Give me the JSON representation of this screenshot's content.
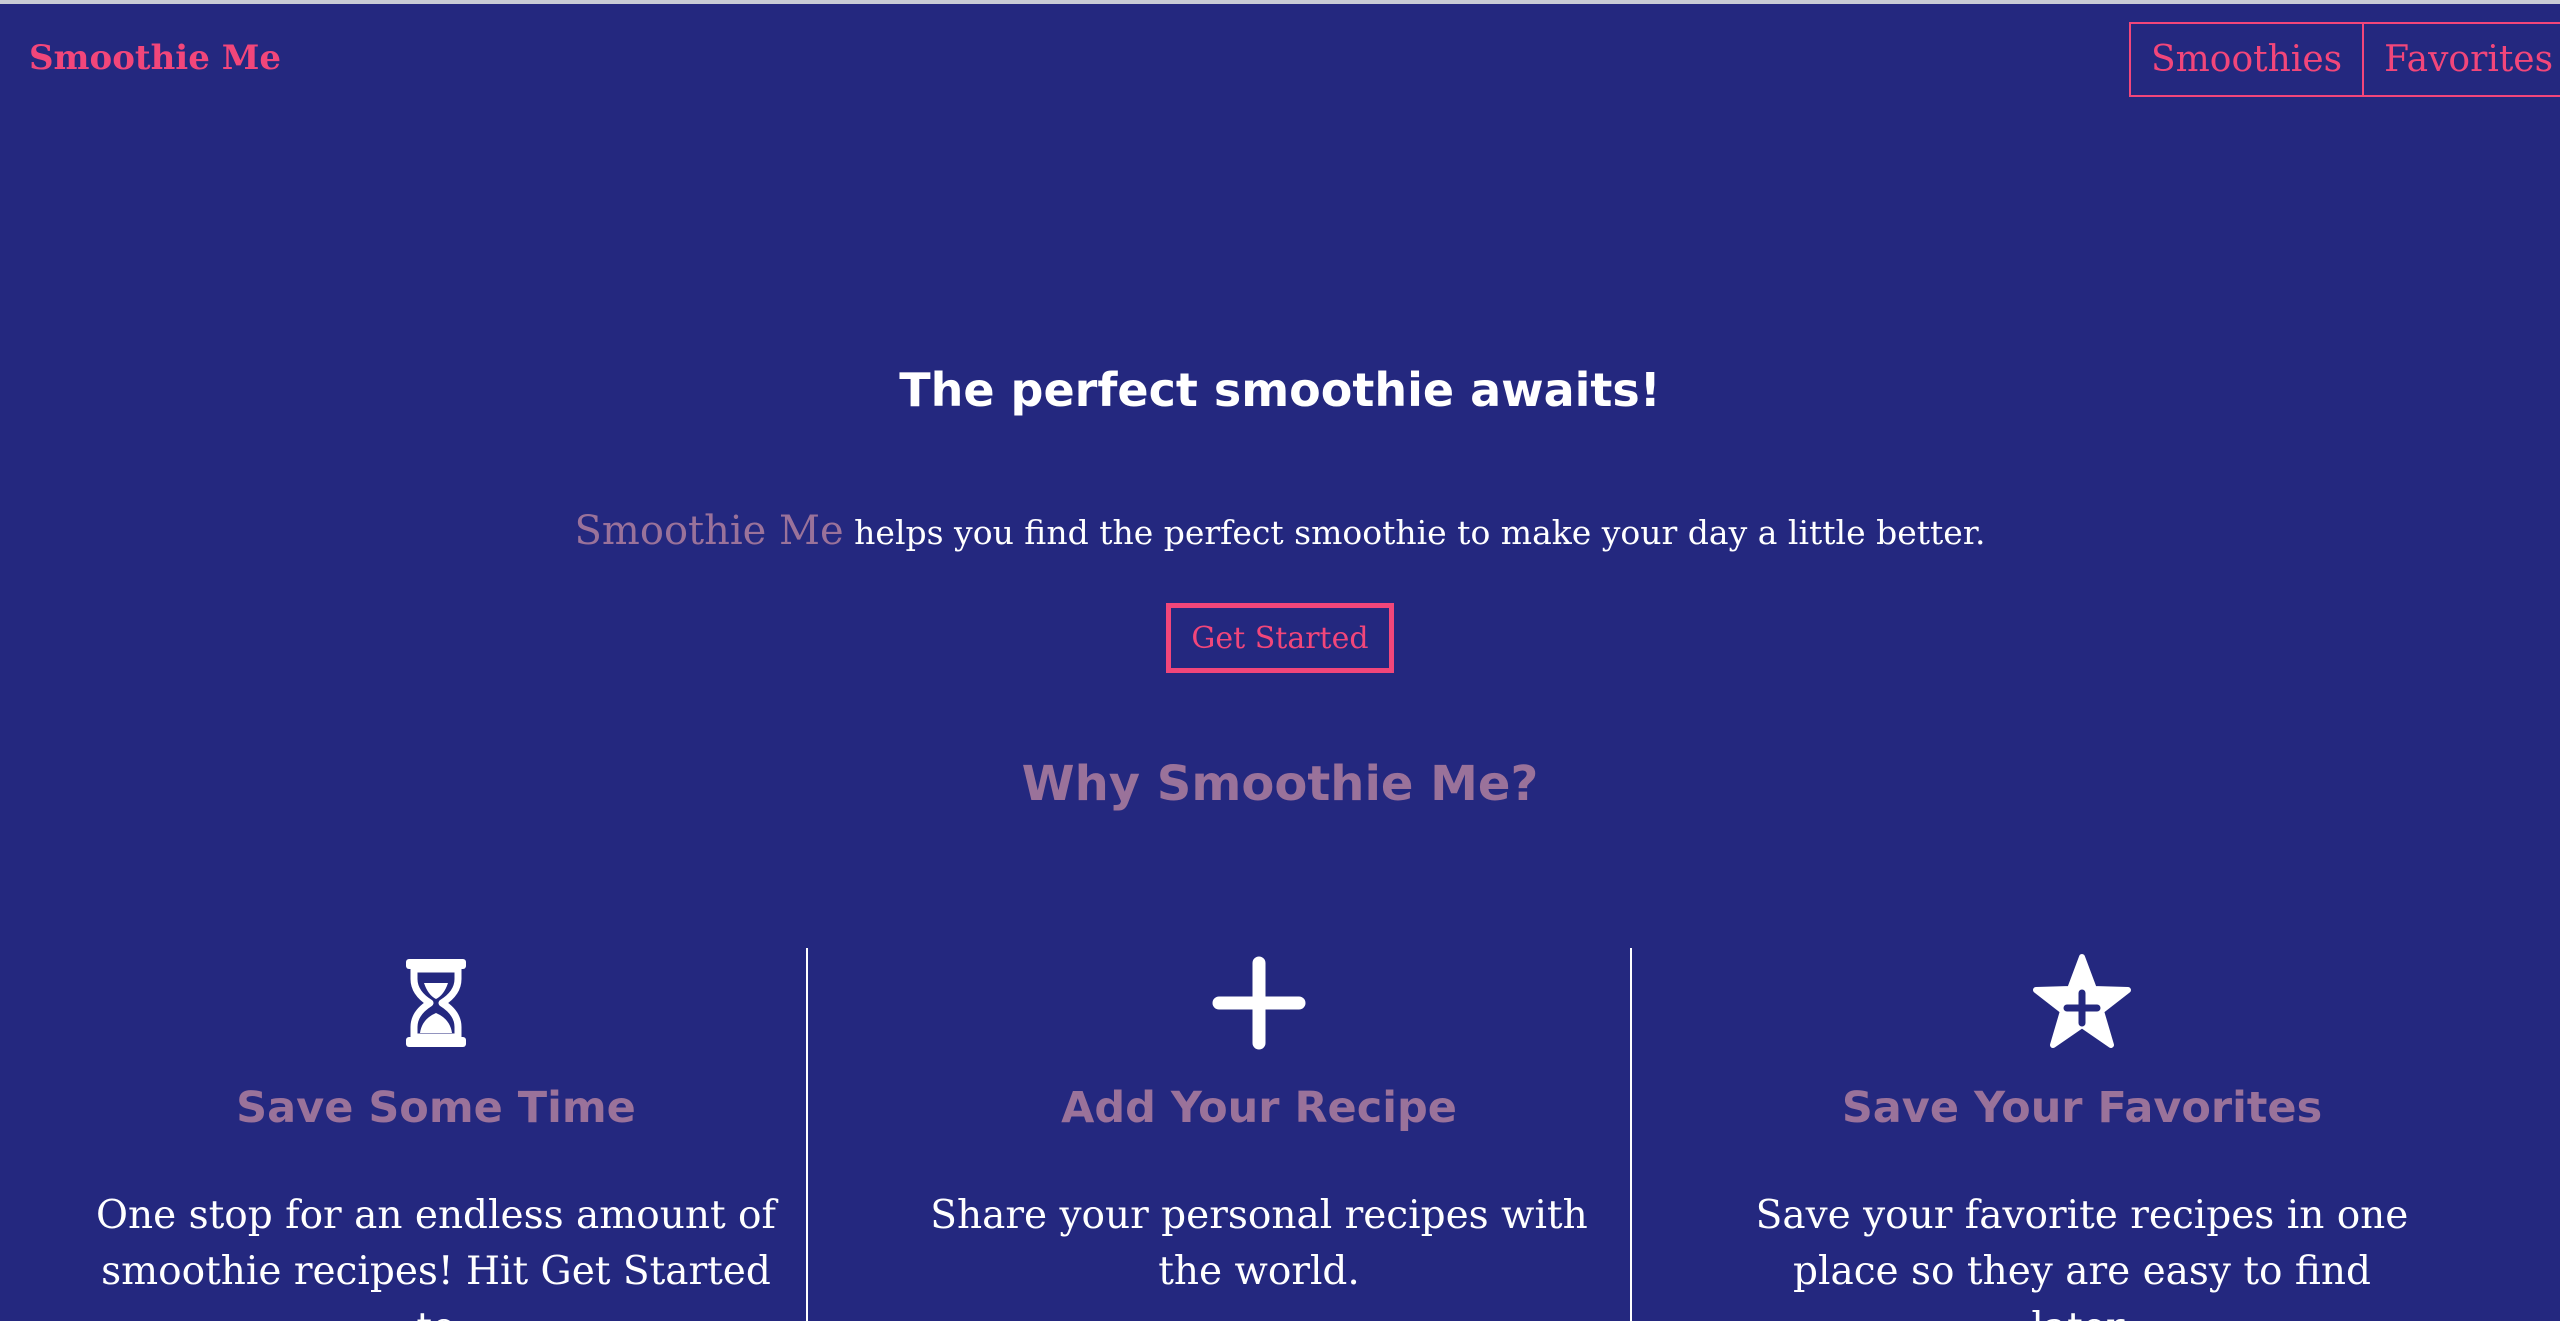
{
  "header": {
    "brand": "Smoothie Me",
    "nav": [
      {
        "label": "Smoothies"
      },
      {
        "label": "Favorites"
      }
    ]
  },
  "hero": {
    "title": "The perfect smoothie awaits!",
    "subtitle_accent": "Smoothie Me",
    "subtitle_rest": "helps you find the perfect smoothie to make your day a little better.",
    "cta_label": "Get Started"
  },
  "why": {
    "title": "Why Smoothie Me?"
  },
  "features": [
    {
      "icon": "hourglass-icon",
      "title": "Save Some Time",
      "text": "One stop for an endless amount of smoothie recipes! Hit Get Started to"
    },
    {
      "icon": "plus-icon",
      "title": "Add Your Recipe",
      "text": "Share your personal recipes with the world."
    },
    {
      "icon": "star-plus-icon",
      "title": "Save Your Favorites",
      "text": "Save your favorite recipes in one place so they are easy to find later."
    }
  ],
  "colors": {
    "background": "#24287f",
    "accent_pink": "#f2467a",
    "muted_purple": "#9a729a",
    "text_white": "#ffffff"
  }
}
